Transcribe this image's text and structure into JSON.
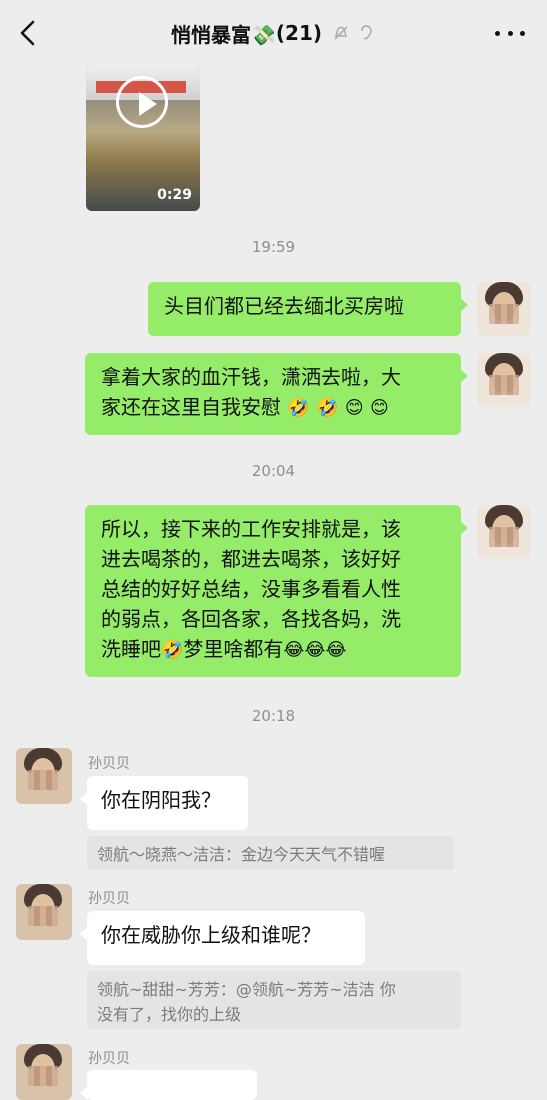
{
  "header": {
    "title": "悄悄暴富💸",
    "count": "(21)"
  },
  "video": {
    "duration": "0:29"
  },
  "timestamps": [
    "19:59",
    "20:04",
    "20:18"
  ],
  "messages": [
    {
      "side": "right",
      "text": "头目们都已经去缅北买房啦"
    },
    {
      "side": "right",
      "text_parts": [
        "拿着大家的血汗钱，潇洒去啦，大",
        "家还在这里自我安慰"
      ],
      "emojis": [
        "🤣",
        "🤣",
        "😊",
        "😊"
      ]
    },
    {
      "side": "right",
      "text_parts": [
        "所以，接下来的工作安排就是，该",
        "进去喝茶的，都进去喝茶，该好好",
        "总结的好好总结，没事多看看人性",
        "的弱点，各回各家，各找各妈，洗",
        "洗睡吧",
        "梦里啥都有"
      ],
      "emojis": [
        "🤣",
        "😂",
        "😂",
        "😂"
      ]
    },
    {
      "side": "left",
      "sender": "孙贝贝",
      "text": "你在阴阳我？",
      "quote": "领航～晓燕～洁洁：金边今天天气不错喔"
    },
    {
      "side": "left",
      "sender": "孙贝贝",
      "text": "你在威胁你上级和谁呢？",
      "quote_parts": [
        "领航~甜甜~芳芳：@领航~芳芳~洁洁 你",
        "没有了，找你的上级"
      ]
    },
    {
      "side": "left",
      "sender": "孙贝贝"
    }
  ]
}
